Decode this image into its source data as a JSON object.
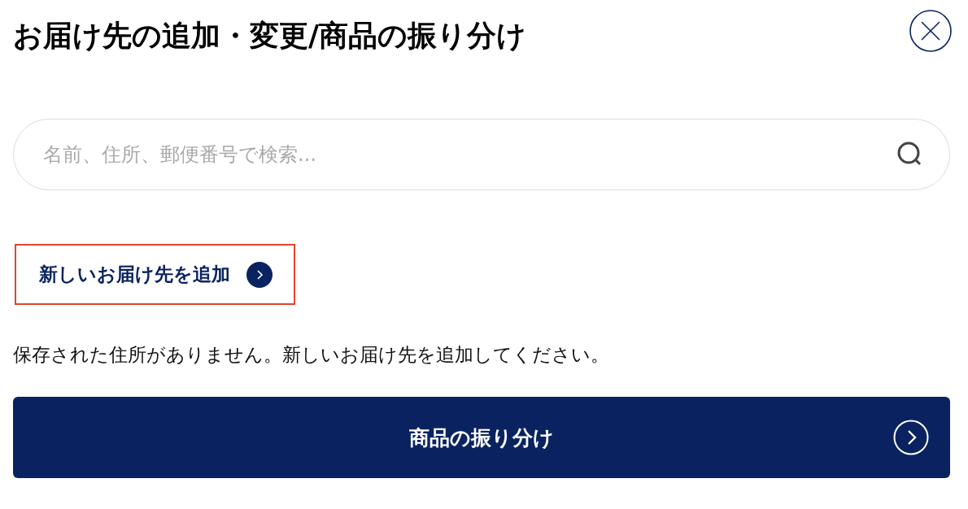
{
  "title": "お届け先の追加・変更/商品の振り分け",
  "search": {
    "placeholder": "名前、住所、郵便番号で検索..."
  },
  "add_address_link": {
    "label": "新しいお届け先を追加",
    "focused": true
  },
  "message": "保存された住所がありません。新しいお届け先を追加してください。",
  "primary_button": {
    "label": "商品の振り分け"
  }
}
